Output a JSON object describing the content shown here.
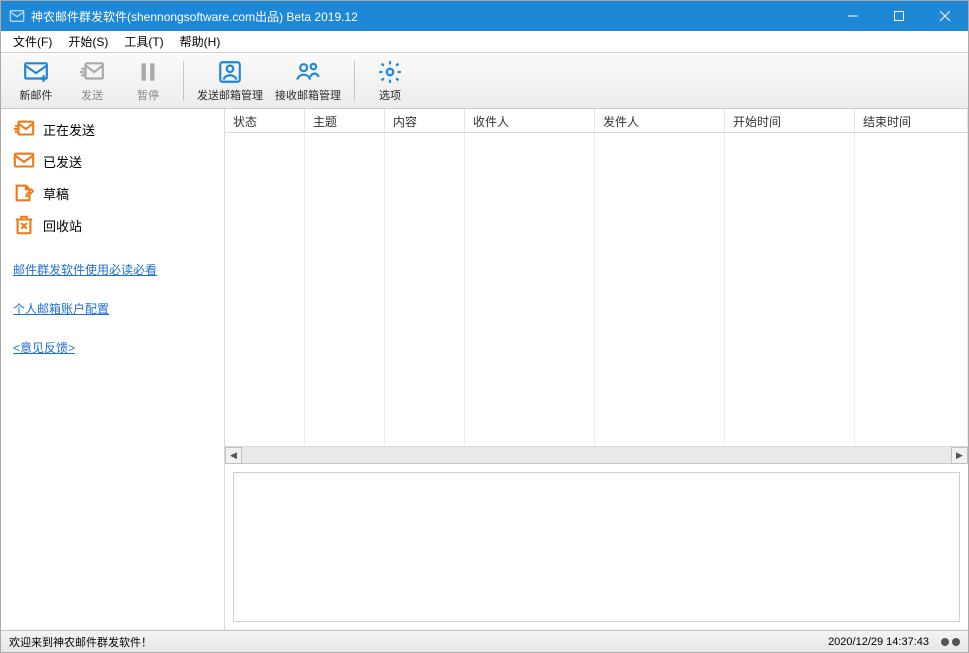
{
  "title": "神农邮件群发软件(shennongsoftware.com出品) Beta 2019.12",
  "menu": {
    "file": "文件(F)",
    "start": "开始(S)",
    "tools": "工具(T)",
    "help": "帮助(H)"
  },
  "toolbar": {
    "new_mail": "新邮件",
    "send": "发送",
    "pause": "暂停",
    "send_mgr": "发送邮箱管理",
    "recv_mgr": "接收邮箱管理",
    "options": "选项"
  },
  "sidebar": {
    "items": [
      {
        "label": "正在发送"
      },
      {
        "label": "已发送"
      },
      {
        "label": "草稿"
      },
      {
        "label": "回收站"
      }
    ],
    "links": {
      "guide": "邮件群发软件使用必读必看",
      "account": "个人邮箱账户配置",
      "feedback": "<意见反馈>"
    }
  },
  "columns": {
    "status": "状态",
    "subject": "主题",
    "content": "内容",
    "recipient": "收件人",
    "sender": "发件人",
    "start_time": "开始时间",
    "end_time": "结束时间"
  },
  "statusbar": {
    "welcome": "欢迎来到神农邮件群发软件！",
    "datetime": "2020/12/29 14:37:43"
  }
}
